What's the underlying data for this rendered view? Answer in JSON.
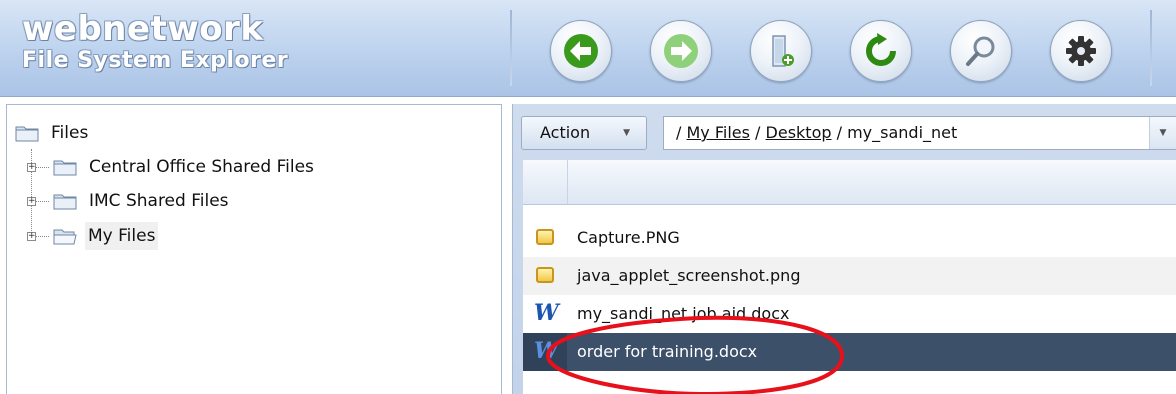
{
  "app": {
    "brand_name": "webnetwork",
    "brand_subtitle": "File System Explorer"
  },
  "toolbar": {
    "buttons": [
      {
        "name": "back",
        "icon": "arrow-left-icon",
        "color": "#3a9a1c"
      },
      {
        "name": "forward",
        "icon": "arrow-right-icon",
        "color": "#8fd07a"
      },
      {
        "name": "add-document",
        "icon": "document-add-icon",
        "color": "#7fb3e0"
      },
      {
        "name": "refresh",
        "icon": "refresh-icon",
        "color": "#2e8a12"
      },
      {
        "name": "search",
        "icon": "magnifier-icon",
        "color": "#7a8a9a"
      },
      {
        "name": "settings",
        "icon": "gear-icon",
        "color": "#333333"
      }
    ]
  },
  "tree": {
    "root": "Files",
    "items": [
      {
        "label": "Central Office Shared Files",
        "icon": "folder-icon"
      },
      {
        "label": "IMC Shared Files",
        "icon": "folder-icon"
      },
      {
        "label": "My Files",
        "icon": "open-folder-icon"
      }
    ]
  },
  "main": {
    "action_label": "Action",
    "path": {
      "sep": "/",
      "parts": [
        "My Files",
        "Desktop",
        "my_sandi_net"
      ]
    }
  },
  "files": [
    {
      "name": "Capture.PNG",
      "icon": "image-icon"
    },
    {
      "name": "java_applet_screenshot.png",
      "icon": "image-icon"
    },
    {
      "name": "my_sandi_net job aid.docx",
      "icon": "word-doc-icon"
    },
    {
      "name": "order for training.docx",
      "icon": "word-doc-icon",
      "selected": true
    }
  ],
  "colors": {
    "selection": "#3c5069",
    "annotation": "#e8101a"
  }
}
